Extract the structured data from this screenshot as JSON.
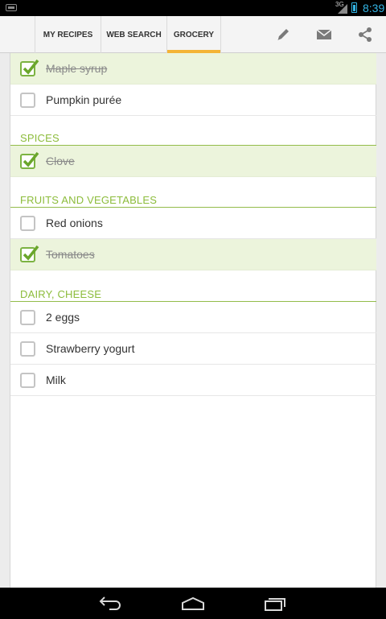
{
  "status_bar": {
    "network": "3G",
    "time": "8:39",
    "accent_color": "#33b5e5"
  },
  "action_bar": {
    "tabs": [
      {
        "label": "MY RECIPES",
        "selected": false
      },
      {
        "label": "WEB SEARCH",
        "selected": false
      },
      {
        "label": "GROCERY",
        "selected": true
      }
    ],
    "actions": [
      "pencil-icon",
      "mail-icon",
      "share-icon"
    ],
    "tab_indicator_color": "#f4b436"
  },
  "grocery": {
    "accent_color": "#8cbc3b",
    "top_items": [
      {
        "label": "Maple syrup",
        "checked": true
      },
      {
        "label": "Pumpkin purée",
        "checked": false
      }
    ],
    "sections": [
      {
        "title": "SPICES",
        "items": [
          {
            "label": "Clove",
            "checked": true
          }
        ]
      },
      {
        "title": "FRUITS AND VEGETABLES",
        "items": [
          {
            "label": "Red onions",
            "checked": false
          },
          {
            "label": "Tomatoes",
            "checked": true
          }
        ]
      },
      {
        "title": "DAIRY, CHEESE",
        "items": [
          {
            "label": "2 eggs",
            "checked": false
          },
          {
            "label": "Strawberry yogurt",
            "checked": false
          },
          {
            "label": "Milk",
            "checked": false
          }
        ]
      }
    ]
  },
  "nav_bar": {
    "buttons": [
      "back-icon",
      "home-icon",
      "recent-apps-icon"
    ]
  }
}
